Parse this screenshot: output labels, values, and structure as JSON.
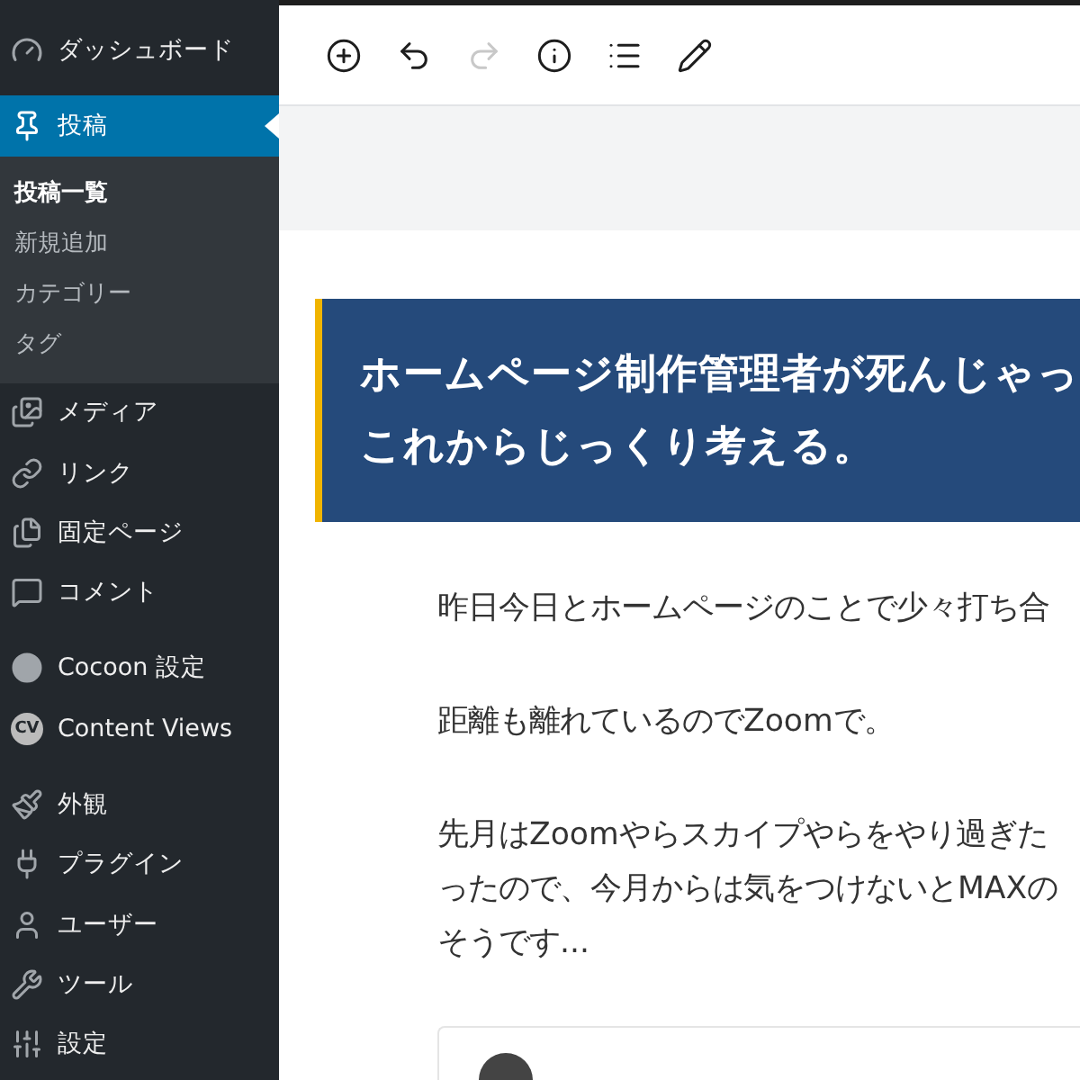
{
  "sidebar": {
    "groups": [
      {
        "items": [
          {
            "label": "ダッシュボード",
            "selected": false
          }
        ]
      },
      {
        "items": [
          {
            "label": "投稿",
            "selected": true,
            "children": [
              {
                "label": "投稿一覧",
                "selected": true
              },
              {
                "label": "新規追加",
                "selected": false
              },
              {
                "label": "カテゴリー",
                "selected": false
              },
              {
                "label": "タグ",
                "selected": false
              }
            ]
          },
          {
            "label": "メディア",
            "selected": false
          },
          {
            "label": "リンク",
            "selected": false
          },
          {
            "label": "固定ページ",
            "selected": false
          },
          {
            "label": "コメント",
            "selected": false
          }
        ]
      },
      {
        "items": [
          {
            "label": "Cocoon 設定",
            "selected": false
          },
          {
            "label": "Content Views",
            "selected": false,
            "badge": "CV"
          }
        ]
      },
      {
        "items": [
          {
            "label": "外観",
            "selected": false
          },
          {
            "label": "プラグイン",
            "selected": false
          },
          {
            "label": "ユーザー",
            "selected": false
          },
          {
            "label": "ツール",
            "selected": false
          },
          {
            "label": "設定",
            "selected": false
          }
        ]
      }
    ]
  },
  "toolbar": {
    "buttons": [
      {
        "disabled": false
      },
      {
        "disabled": false
      },
      {
        "disabled": true
      },
      {
        "disabled": false
      },
      {
        "disabled": false
      },
      {
        "disabled": false
      }
    ]
  },
  "post": {
    "title_lines": [
      "ホームページ制作管理者が死んじゃっ",
      "これからじっくり考える。"
    ],
    "paragraphs": [
      [
        "昨日今日とホームページのことで少々打ち合"
      ],
      [
        "距離も離れているのでZoomで。"
      ],
      [
        "先月はZoomやらスカイプやらをやり過ぎた",
        "ったので、今月からは気をつけないとMAXの",
        "そうです..."
      ]
    ]
  }
}
